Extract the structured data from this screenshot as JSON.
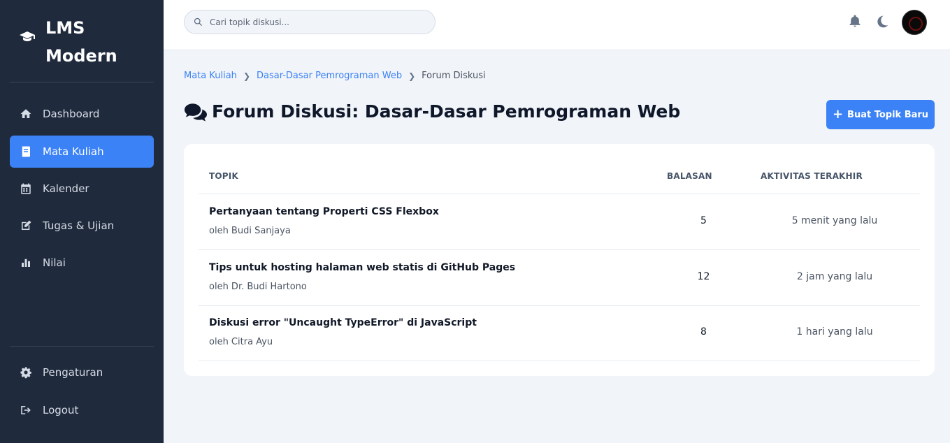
{
  "app": {
    "name": "LMS\nModern"
  },
  "sidebar": {
    "items": [
      {
        "label": "Dashboard",
        "icon": "home-icon",
        "active": false
      },
      {
        "label": "Mata Kuliah",
        "icon": "book-icon",
        "active": true
      },
      {
        "label": "Kalender",
        "icon": "calendar-icon",
        "active": false
      },
      {
        "label": "Tugas & Ujian",
        "icon": "edit-icon",
        "active": false
      },
      {
        "label": "Nilai",
        "icon": "bar-chart-icon",
        "active": false
      }
    ],
    "bottom": [
      {
        "label": "Pengaturan",
        "icon": "gear-icon"
      },
      {
        "label": "Logout",
        "icon": "logout-icon"
      }
    ]
  },
  "header": {
    "search_placeholder": "Cari topik diskusi..."
  },
  "breadcrumb": {
    "items": [
      "Mata Kuliah",
      "Dasar-Dasar Pemrograman Web"
    ],
    "current": "Forum Diskusi"
  },
  "page": {
    "title": "Forum Diskusi: Dasar-Dasar Pemrograman Web",
    "new_topic_label": "Buat Topik Baru"
  },
  "table": {
    "headers": {
      "topic": "TOPIK",
      "replies": "BALASAN",
      "activity": "AKTIVITAS TERAKHIR"
    },
    "rows": [
      {
        "title": "Pertanyaan tentang Properti CSS Flexbox",
        "author": "oleh Budi Sanjaya",
        "replies": "5",
        "activity": "5 menit yang lalu"
      },
      {
        "title": "Tips untuk hosting halaman web statis di GitHub Pages",
        "author": "oleh Dr. Budi Hartono",
        "replies": "12",
        "activity": "2 jam yang lalu"
      },
      {
        "title": "Diskusi error \"Uncaught TypeError\" di JavaScript",
        "author": "oleh Citra Ayu",
        "replies": "8",
        "activity": "1 hari yang lalu"
      }
    ]
  },
  "colors": {
    "sidebar": "#1f2a3c",
    "accent": "#3b82f6",
    "background": "#f1f4f8"
  }
}
